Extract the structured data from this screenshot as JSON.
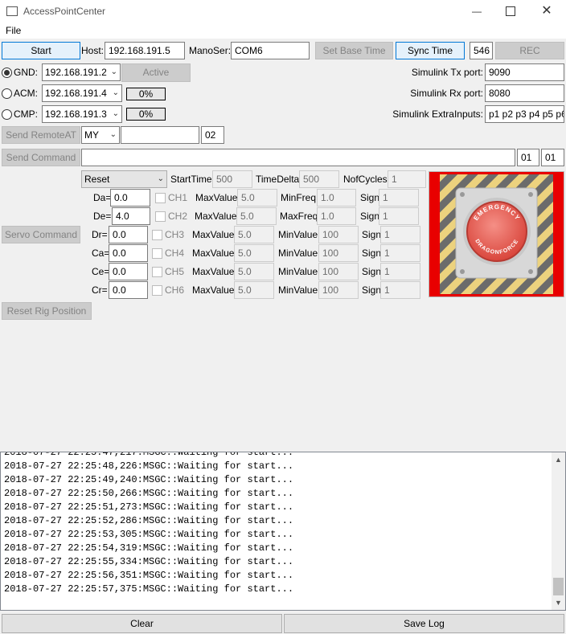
{
  "window": {
    "title": "AccessPointCenter"
  },
  "menu": {
    "file": "File"
  },
  "top": {
    "start": "Start",
    "host_label": "Host:",
    "host_value": "192.168.191.5",
    "manoser_label": "ManoSer:",
    "manoser_value": "COM6",
    "set_base_time": "Set Base Time",
    "sync_time": "Sync Time",
    "counter": "546",
    "rec": "REC"
  },
  "links": [
    {
      "label": "GND:",
      "ip": "192.168.191.2",
      "selected": true
    },
    {
      "label": "ACM:",
      "ip": "192.168.191.4",
      "progress": "0%"
    },
    {
      "label": "CMP:",
      "ip": "192.168.191.3",
      "progress": "0%"
    }
  ],
  "active_button": "Active",
  "simulink": {
    "tx_label": "Simulink Tx port:",
    "tx_value": "9090",
    "rx_label": "Simulink Rx port:",
    "rx_value": "8080",
    "extra_label": "Simulink ExtraInputs:",
    "extra_value": "p1 p2 p3 p4 p5 p6"
  },
  "remote_at": {
    "button": "Send RemoteAT",
    "cmd": "MY",
    "param": "",
    "value": "02"
  },
  "command": {
    "button": "Send Command",
    "text": "",
    "box1": "01",
    "box2": "01"
  },
  "servo": {
    "button": "Servo Command",
    "mode": "Reset",
    "start_time_label": "StartTime",
    "start_time": "500",
    "time_delta_label": "TimeDelta",
    "time_delta": "500",
    "nof_cycles_label": "NofCycles",
    "nof_cycles": "1",
    "rows": [
      {
        "name": "Da=",
        "value": "0.0",
        "ch": "CH1",
        "max_label": "MaxValue",
        "max": "5.0",
        "third_label": "MinFreq",
        "third": "1.0",
        "sign_label": "Sign",
        "sign": "1"
      },
      {
        "name": "De=",
        "value": "4.0",
        "ch": "CH2",
        "max_label": "MaxValue",
        "max": "5.0",
        "third_label": "MaxFreq",
        "third": "1.0",
        "sign_label": "Sign",
        "sign": "1"
      },
      {
        "name": "Dr=",
        "value": "0.0",
        "ch": "CH3",
        "max_label": "MaxValue",
        "max": "5.0",
        "third_label": "MinValue",
        "third": "100",
        "sign_label": "Sign",
        "sign": "1"
      },
      {
        "name": "Ca=",
        "value": "0.0",
        "ch": "CH4",
        "max_label": "MaxValue",
        "max": "5.0",
        "third_label": "MinValue",
        "third": "100",
        "sign_label": "Sign",
        "sign": "1"
      },
      {
        "name": "Ce=",
        "value": "0.0",
        "ch": "CH5",
        "max_label": "MaxValue",
        "max": "5.0",
        "third_label": "MinValue",
        "third": "100",
        "sign_label": "Sign",
        "sign": "1"
      },
      {
        "name": "Cr=",
        "value": "0.0",
        "ch": "CH6",
        "max_label": "MaxValue",
        "max": "5.0",
        "third_label": "MinValue",
        "third": "100",
        "sign_label": "Sign",
        "sign": "1"
      }
    ]
  },
  "emergency": {
    "top_text": "EMERGENCY",
    "bottom_text": "DRAGONFORCE"
  },
  "reset_rig": "Reset Rig Position",
  "log_lines": [
    "2018-07-27 22:25:48,226:MSGC::Waiting for start...",
    "2018-07-27 22:25:49,240:MSGC::Waiting for start...",
    "2018-07-27 22:25:50,266:MSGC::Waiting for start...",
    "2018-07-27 22:25:51,273:MSGC::Waiting for start...",
    "2018-07-27 22:25:52,286:MSGC::Waiting for start...",
    "2018-07-27 22:25:53,305:MSGC::Waiting for start...",
    "2018-07-27 22:25:54,319:MSGC::Waiting for start...",
    "2018-07-27 22:25:55,334:MSGC::Waiting for start...",
    "2018-07-27 22:25:56,351:MSGC::Waiting for start...",
    "2018-07-27 22:25:57,375:MSGC::Waiting for start..."
  ],
  "bottom": {
    "clear": "Clear",
    "save_log": "Save Log"
  }
}
